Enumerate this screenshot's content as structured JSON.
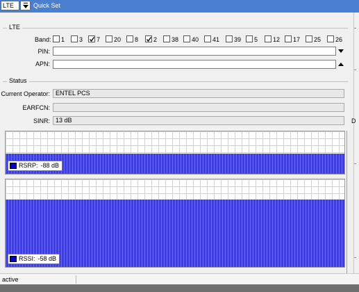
{
  "window": {
    "mode_select_value": "LTE",
    "title": "Quick Set"
  },
  "lte": {
    "section_title": "LTE",
    "band_label": "Band:",
    "bands": [
      {
        "label": "1",
        "checked": false
      },
      {
        "label": "3",
        "checked": false
      },
      {
        "label": "7",
        "checked": true
      },
      {
        "label": "20",
        "checked": false
      },
      {
        "label": "8",
        "checked": false
      },
      {
        "label": "2",
        "checked": true
      },
      {
        "label": "38",
        "checked": false
      },
      {
        "label": "40",
        "checked": false
      },
      {
        "label": "41",
        "checked": false
      },
      {
        "label": "39",
        "checked": false
      },
      {
        "label": "5",
        "checked": false
      },
      {
        "label": "12",
        "checked": false
      },
      {
        "label": "17",
        "checked": false
      },
      {
        "label": "25",
        "checked": false
      },
      {
        "label": "26",
        "checked": false
      }
    ],
    "pin_label": "PIN:",
    "pin_value": "",
    "apn_label": "APN:",
    "apn_value": ""
  },
  "status": {
    "section_title": "Status",
    "operator_label": "Current Operator:",
    "operator_value": "ENTEL PCS",
    "earfcn_label": "EARFCN:",
    "earfcn_value": "",
    "sinr_label": "SINR:",
    "sinr_value": "13 dB",
    "clipped_right_text": "D"
  },
  "graphs": {
    "rsrp": {
      "label": "RSRP:",
      "value": "-88 dB",
      "fill_fraction": 0.48,
      "color": "#0000d8"
    },
    "rssi": {
      "label": "RSSI:",
      "value": "-58 dB",
      "fill_fraction": 0.77,
      "color": "#0000d8"
    }
  },
  "statusbar": {
    "text": "active"
  },
  "colors": {
    "titlebar": "#4a7fd0",
    "graph_fill": "#3c3cf0"
  }
}
